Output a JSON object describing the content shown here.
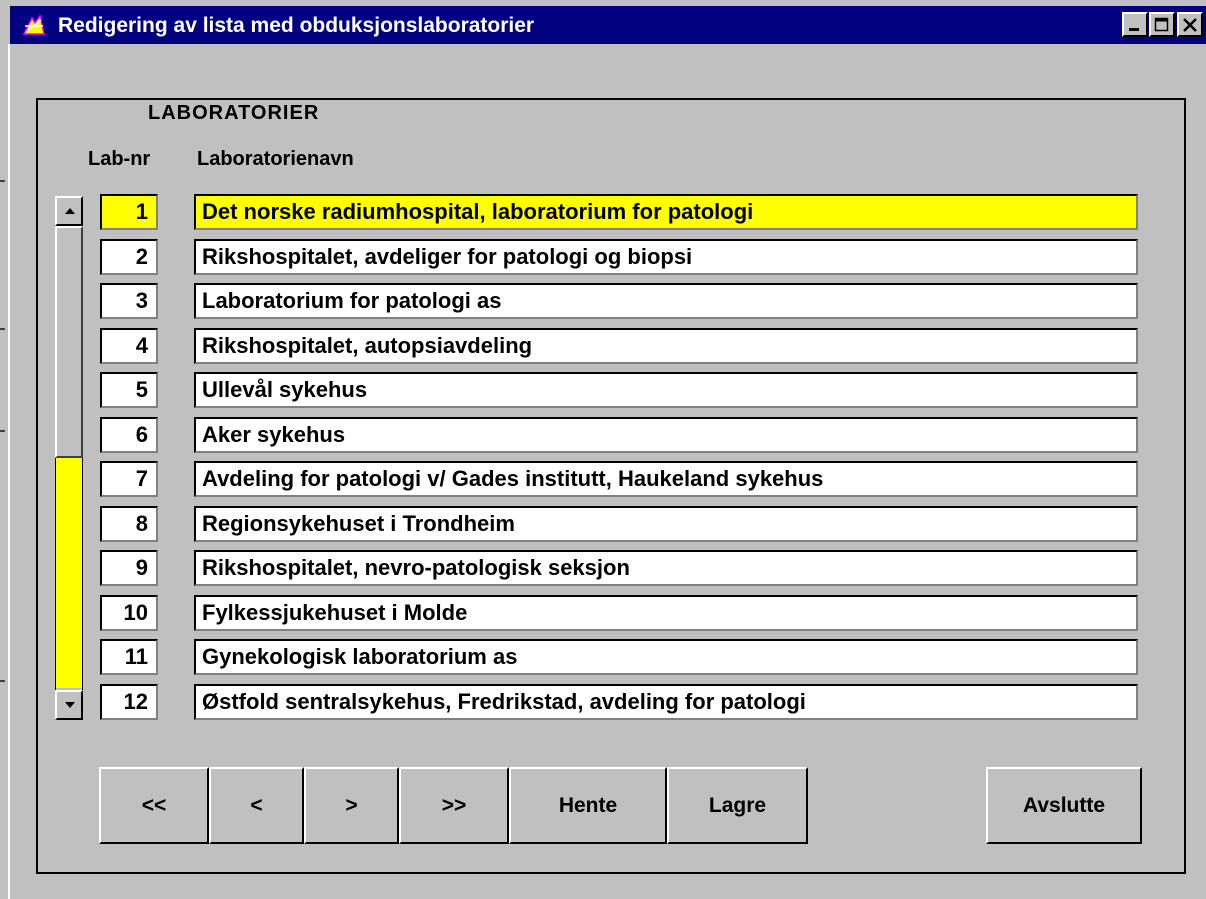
{
  "window": {
    "title": "Redigering av lista med obduksjonslaboratorier",
    "controls": {
      "minimize": "minimize-icon",
      "maximize": "maximize-icon",
      "close": "close-icon"
    }
  },
  "group": {
    "legend": "LABORATORIER"
  },
  "columns": {
    "lab_nr": "Lab-nr",
    "name": "Laboratorienavn"
  },
  "rows": [
    {
      "nr": "1",
      "name": "Det norske radiumhospital, laboratorium for patologi",
      "active": true
    },
    {
      "nr": "2",
      "name": "Rikshospitalet, avdeliger for patologi og biopsi"
    },
    {
      "nr": "3",
      "name": "Laboratorium for patologi as"
    },
    {
      "nr": "4",
      "name": "Rikshospitalet, autopsiavdeling"
    },
    {
      "nr": "5",
      "name": "Ullevål sykehus"
    },
    {
      "nr": "6",
      "name": "Aker sykehus"
    },
    {
      "nr": "7",
      "name": "Avdeling for patologi v/ Gades institutt, Haukeland sykehus"
    },
    {
      "nr": "8",
      "name": "Regionsykehuset i Trondheim"
    },
    {
      "nr": "9",
      "name": "Rikshospitalet, nevro-patologisk seksjon"
    },
    {
      "nr": "10",
      "name": "Fylkessjukehuset i Molde"
    },
    {
      "nr": "11",
      "name": "Gynekologisk laboratorium as"
    },
    {
      "nr": "12",
      "name": "Østfold sentralsykehus, Fredrikstad, avdeling for patologi"
    }
  ],
  "buttons": {
    "first": "<<",
    "prev": "<",
    "next": ">",
    "last": ">>",
    "fetch": "Hente",
    "save": "Lagre",
    "exit": "Avslutte"
  },
  "colors": {
    "highlight": "#ffff00",
    "titlebar": "#000080",
    "face": "#c0c0c0"
  }
}
